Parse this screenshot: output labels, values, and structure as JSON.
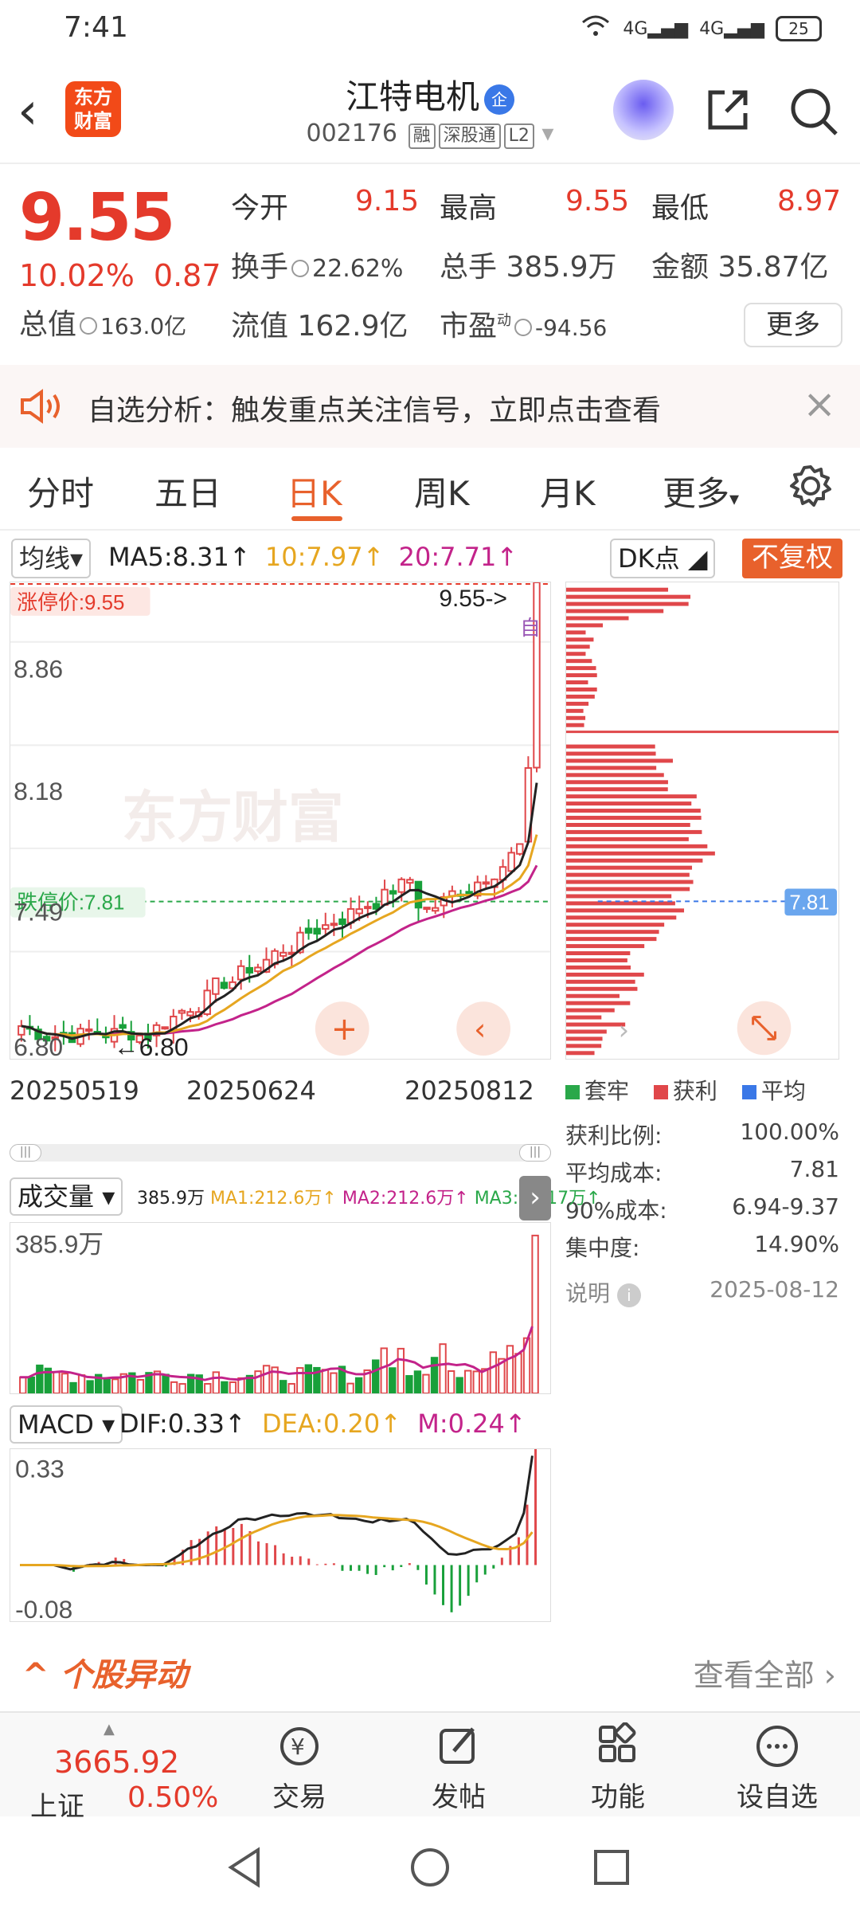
{
  "status": {
    "time": "7:41",
    "net1": "4G",
    "net2": "4G",
    "battery": "25"
  },
  "header": {
    "logo_text": "东方财富",
    "stock_name": "江特电机",
    "badge": "企",
    "stock_code": "002176",
    "tags": [
      "融",
      "深股通",
      "L2"
    ]
  },
  "quote": {
    "price": "9.55",
    "change_pct": "10.02%",
    "change_amt": "0.87",
    "open_label": "今开",
    "open": "9.15",
    "high_label": "最高",
    "high": "9.55",
    "low_label": "最低",
    "low": "8.97",
    "turnover_label": "换手",
    "turnover": "22.62%",
    "volume_label": "总手",
    "volume": "385.9万",
    "amount_label": "金额",
    "amount": "35.87亿",
    "mktcap_label": "总值",
    "mktcap": "163.0亿",
    "float_label": "流值",
    "float": "162.9亿",
    "pe_label": "市盈",
    "pe_sup": "动",
    "pe": "-94.56",
    "more": "更多"
  },
  "banner": {
    "text": "自选分析：触发重点关注信号，立即点击查看"
  },
  "tabs": [
    "分时",
    "五日",
    "日K",
    "周K",
    "月K",
    "更多"
  ],
  "active_tab": "日K",
  "chart": {
    "ma_selector": "均线",
    "ma5": "MA5:8.31↑",
    "ma10": "10:7.97↑",
    "ma20": "20:7.71↑",
    "dk": "DK点",
    "fq": "不复权",
    "limit_up": "涨停价:9.55",
    "limit_down": "跌停价:7.81",
    "price_marker": "9.55->",
    "low_marker": "←6.80",
    "self_tag": "自",
    "watermark": "东方财富",
    "y_ticks": [
      "8.86",
      "8.18",
      "7.49",
      "6.80"
    ],
    "dates": [
      "20250519",
      "20250624",
      "20250812"
    ],
    "dist_label": "7.81"
  },
  "chip": {
    "legend": [
      "套牢",
      "获利",
      "平均"
    ],
    "colors": {
      "trapped": "#2aa84a",
      "profit": "#e0474a",
      "avg": "#3a78e7"
    },
    "rows": [
      {
        "label": "获利比例:",
        "value": "100.00%"
      },
      {
        "label": "平均成本:",
        "value": "7.81"
      },
      {
        "label": "90%成本:",
        "value": "6.94-9.37"
      },
      {
        "label": "集中度:",
        "value": "14.90%"
      }
    ],
    "note_label": "说明",
    "note_date": "2025-08-12"
  },
  "volume": {
    "selector": "成交量",
    "total": "385.9万",
    "ma1": "MA1:212.6万↑",
    "ma2": "MA2:212.6万↑",
    "ma3": "MA3:41.17万↑",
    "top_label": "385.9万"
  },
  "macd": {
    "selector": "MACD",
    "dif": "DIF:0.33↑",
    "dea": "DEA:0.20↑",
    "m": "M:0.24↑",
    "top": "0.33",
    "bottom": "-0.08"
  },
  "anomaly": {
    "title": "个股异动",
    "link": "查看全部"
  },
  "bottom": {
    "index_value": "3665.92",
    "index_name": "上证",
    "index_change": "0.50%",
    "buttons": [
      "交易",
      "发帖",
      "功能",
      "设自选"
    ]
  },
  "chart_data": {
    "type": "candlestick",
    "title": "",
    "y_ticks": [
      8.86,
      8.18,
      7.49,
      6.8
    ],
    "ylim": [
      6.8,
      9.55
    ],
    "x_dates": [
      "20250519",
      "20250624",
      "20250812"
    ],
    "last_close": 9.55,
    "limit_up": 9.55,
    "limit_down": 7.81,
    "min_marked": 6.8,
    "ma": {
      "MA5": 8.31,
      "MA10": 7.97,
      "MA20": 7.71
    }
  }
}
